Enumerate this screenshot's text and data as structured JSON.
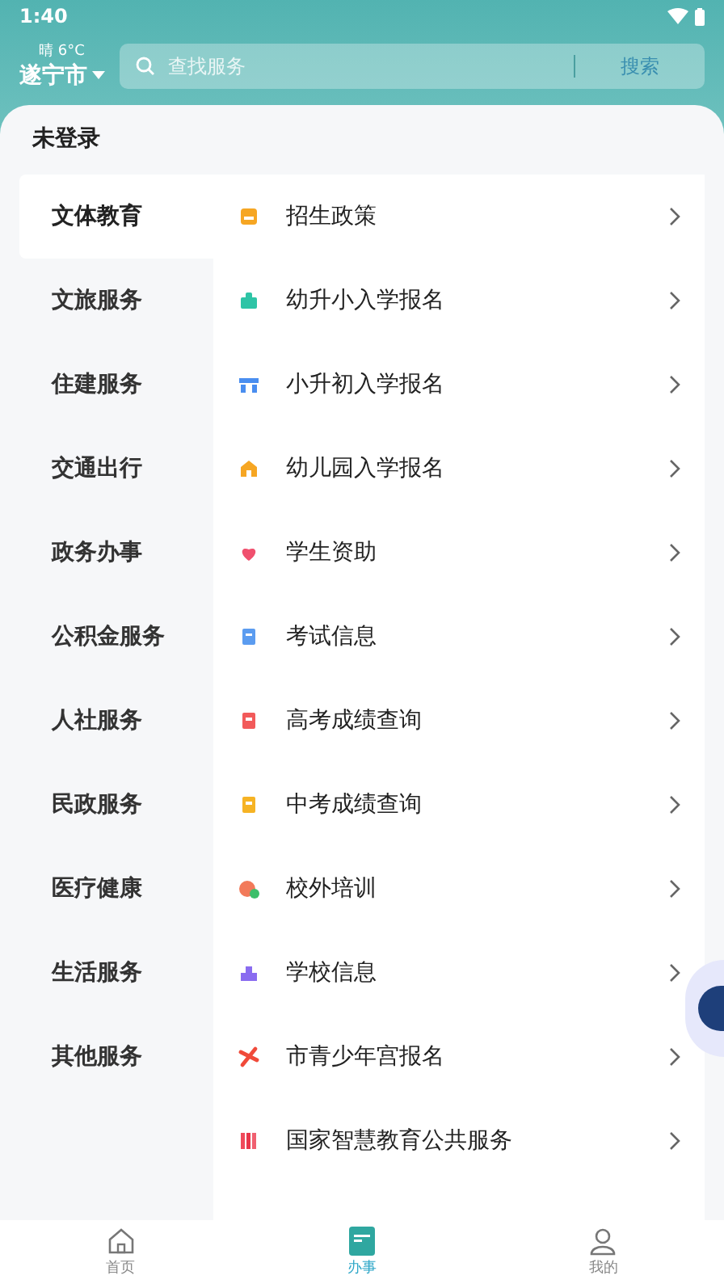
{
  "status_bar": {
    "time": "1:40"
  },
  "header": {
    "weather": "晴 6°C",
    "city": "遂宁市",
    "search": {
      "placeholder": "查找服务",
      "button": "搜索"
    }
  },
  "login_status": "未登录",
  "categories": [
    {
      "label": "文体教育",
      "selected": true
    },
    {
      "label": "文旅服务",
      "selected": false
    },
    {
      "label": "住建服务",
      "selected": false
    },
    {
      "label": "交通出行",
      "selected": false
    },
    {
      "label": "政务办事",
      "selected": false
    },
    {
      "label": "公积金服务",
      "selected": false
    },
    {
      "label": "人社服务",
      "selected": false
    },
    {
      "label": "民政服务",
      "selected": false
    },
    {
      "label": "医疗健康",
      "selected": false
    },
    {
      "label": "生活服务",
      "selected": false
    },
    {
      "label": "其他服务",
      "selected": false
    }
  ],
  "services": [
    {
      "label": "招生政策"
    },
    {
      "label": "幼升小入学报名"
    },
    {
      "label": "小升初入学报名"
    },
    {
      "label": "幼儿园入学报名"
    },
    {
      "label": "学生资助"
    },
    {
      "label": "考试信息"
    },
    {
      "label": "高考成绩查询"
    },
    {
      "label": "中考成绩查询"
    },
    {
      "label": "校外培训"
    },
    {
      "label": "学校信息"
    },
    {
      "label": "市青少年宫报名"
    },
    {
      "label": "国家智慧教育公共服务"
    }
  ],
  "bottom_nav": [
    {
      "label": "首页",
      "selected": false
    },
    {
      "label": "办事",
      "selected": true
    },
    {
      "label": "我的",
      "selected": false
    }
  ]
}
